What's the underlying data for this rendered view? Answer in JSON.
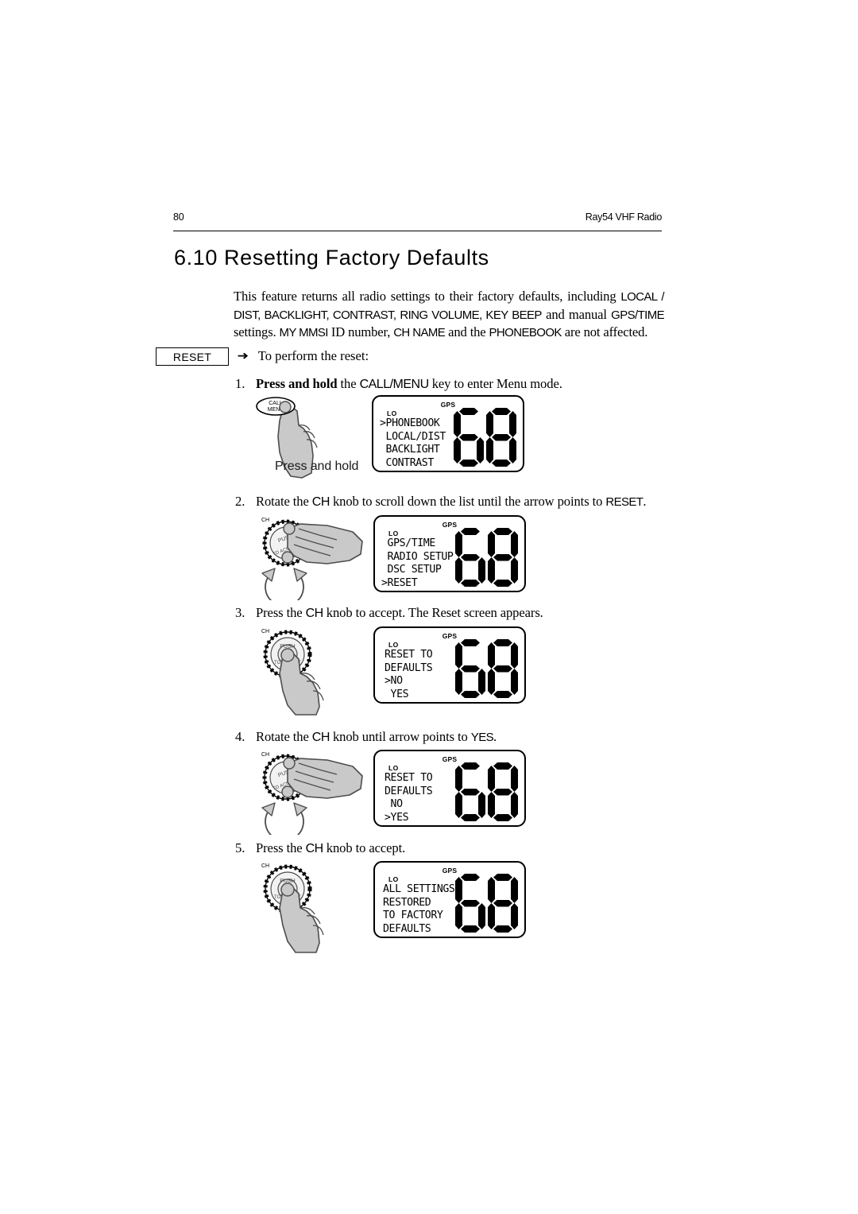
{
  "runhead": {
    "page_number": "80",
    "manual_title": "Ray54 VHF Radio"
  },
  "heading": "6.10 Resetting Factory Defaults",
  "intro": {
    "part1": "This feature returns all radio settings to their factory defaults, including ",
    "caps1": "LOCAL / DIST, BACKLIGHT, CONTRAST, RING VOLUME, KEY BEEP",
    "part2": " and manual ",
    "caps2": "GPS/TIME",
    "part3": " settings. ",
    "caps3": "MY MMSI",
    "part4": " ID number, ",
    "caps4": "CH NAME",
    "part5": " and the ",
    "caps5": "PHONEBOOK",
    "part6": " are not affected."
  },
  "margin_badge": "RESET",
  "bullet": {
    "arrow": "➜",
    "text": "To perform the reset:"
  },
  "steps": [
    {
      "number": "1.",
      "bold_lead": "Press and hold",
      "mid": " the ",
      "caps": "CALL/MENU",
      "tail": " key to enter Menu mode.",
      "illustration": "call-menu-press-hold",
      "illustration_label": "Press and hold",
      "lcd": {
        "gps": "GPS",
        "lo": "LO",
        "lines": [
          ">PHONEBOOK",
          " LOCAL/DIST",
          " BACKLIGHT",
          " CONTRAST"
        ],
        "digits": "68"
      }
    },
    {
      "number": "2.",
      "bold_lead": "",
      "mid": "Rotate the ",
      "caps": "CH",
      "tail": " knob to scroll down the list until the arrow points to ",
      "caps_end": "RESET",
      "tail_end": ".",
      "illustration": "ch-knob-rotate",
      "illustration_label": "",
      "lcd": {
        "gps": "GPS",
        "lo": "LO",
        "lines": [
          " GPS/TIME",
          " RADIO SETUP",
          " DSC SETUP",
          ">RESET"
        ],
        "digits": "68"
      }
    },
    {
      "number": "3.",
      "bold_lead": "",
      "mid": "Press the ",
      "caps": "CH",
      "tail": " knob to accept. The Reset screen appears.",
      "illustration": "ch-knob-press",
      "illustration_label": "",
      "lcd": {
        "gps": "GPS",
        "lo": "LO",
        "lines": [
          "RESET TO",
          "DEFAULTS",
          ">NO",
          " YES"
        ],
        "digits": "68"
      }
    },
    {
      "number": "4.",
      "bold_lead": "",
      "mid": "Rotate the ",
      "caps": "CH",
      "tail": " knob until arrow points to ",
      "caps_end": "YES",
      "tail_end": ".",
      "illustration": "ch-knob-rotate",
      "illustration_label": "",
      "lcd": {
        "gps": "GPS",
        "lo": "LO",
        "lines": [
          "RESET TO",
          "DEFAULTS",
          " NO",
          ">YES"
        ],
        "digits": "68"
      }
    },
    {
      "number": "5.",
      "bold_lead": "",
      "mid": "Press the ",
      "caps": "CH",
      "tail": " knob to accept.",
      "illustration": "ch-knob-press",
      "illustration_label": "",
      "lcd": {
        "gps": "GPS",
        "lo": "LO",
        "lines": [
          "ALL SETTINGS",
          "RESTORED",
          "TO FACTORY",
          "DEFAULTS"
        ],
        "digits": "68"
      }
    }
  ],
  "knob_labels": {
    "ch": "CH",
    "push": "PUSH",
    "call": "CALL",
    "menu": "MENU"
  },
  "colors": {
    "ink": "#000000",
    "paper": "#ffffff",
    "hand_fill": "#c9c9c9",
    "hand_stroke": "#4d4d4d"
  }
}
